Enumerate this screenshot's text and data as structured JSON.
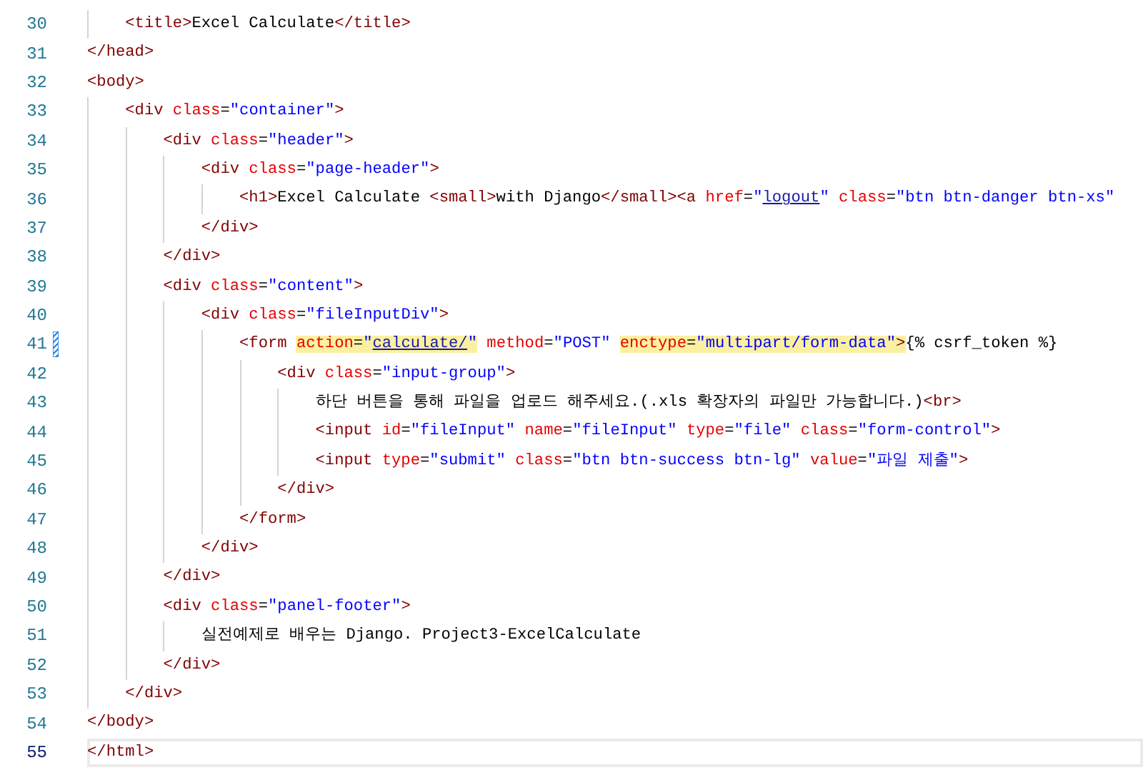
{
  "lines": [
    {
      "children": [
        {
          "number": "30",
          "current": false,
          "modified": false,
          "tokens": [
            {
              "kind": "tag",
              "text": "<title>"
            },
            {
              "kind": "text",
              "text": "Excel Calculate"
            },
            {
              "kind": "tag",
              "text": "</title>"
            }
          ]
        }
      ]
    },
    {
      "number": "31",
      "current": false,
      "modified": false,
      "tokens": [
        {
          "kind": "tag",
          "text": "</head>"
        }
      ]
    },
    {
      "number": "32",
      "current": false,
      "modified": false,
      "tokens": [
        {
          "kind": "tag",
          "text": "<body>"
        }
      ],
      "children": [
        {
          "number": "33",
          "current": false,
          "modified": false,
          "tokens": [
            {
              "kind": "tag",
              "text": "<div"
            },
            {
              "kind": "attr",
              "text": " class"
            },
            {
              "kind": "text",
              "text": "="
            },
            {
              "kind": "string",
              "text": "\"container\""
            },
            {
              "kind": "tag",
              "text": ">"
            }
          ],
          "children": [
            {
              "number": "34",
              "current": false,
              "modified": false,
              "tokens": [
                {
                  "kind": "tag",
                  "text": "<div"
                },
                {
                  "kind": "attr",
                  "text": " class"
                },
                {
                  "kind": "text",
                  "text": "="
                },
                {
                  "kind": "string",
                  "text": "\"header\""
                },
                {
                  "kind": "tag",
                  "text": ">"
                }
              ],
              "children": [
                {
                  "number": "35",
                  "current": false,
                  "modified": false,
                  "tokens": [
                    {
                      "kind": "tag",
                      "text": "<div"
                    },
                    {
                      "kind": "attr",
                      "text": " class"
                    },
                    {
                      "kind": "text",
                      "text": "="
                    },
                    {
                      "kind": "string",
                      "text": "\"page-header\""
                    },
                    {
                      "kind": "tag",
                      "text": ">"
                    }
                  ],
                  "children": [
                    {
                      "number": "36",
                      "current": false,
                      "modified": false,
                      "tokens": [
                        {
                          "kind": "tag",
                          "text": "<h1>"
                        },
                        {
                          "kind": "text",
                          "text": "Excel Calculate "
                        },
                        {
                          "kind": "tag",
                          "text": "<small>"
                        },
                        {
                          "kind": "text",
                          "text": "with Django"
                        },
                        {
                          "kind": "tag",
                          "text": "</small><a"
                        },
                        {
                          "kind": "attr",
                          "text": " href"
                        },
                        {
                          "kind": "text",
                          "text": "="
                        },
                        {
                          "kind": "string",
                          "text": "\""
                        },
                        {
                          "kind": "link",
                          "text": "logout"
                        },
                        {
                          "kind": "string",
                          "text": "\""
                        },
                        {
                          "kind": "attr",
                          "text": " class"
                        },
                        {
                          "kind": "text",
                          "text": "="
                        },
                        {
                          "kind": "string",
                          "text": "\"btn btn-danger btn-xs\""
                        }
                      ]
                    }
                  ]
                },
                {
                  "number": "37",
                  "current": false,
                  "modified": false,
                  "tokens": [
                    {
                      "kind": "tag",
                      "text": "</div>"
                    }
                  ]
                }
              ]
            },
            {
              "number": "38",
              "current": false,
              "modified": false,
              "tokens": [
                {
                  "kind": "tag",
                  "text": "</div>"
                }
              ]
            },
            {
              "number": "39",
              "current": false,
              "modified": false,
              "tokens": [
                {
                  "kind": "tag",
                  "text": "<div"
                },
                {
                  "kind": "attr",
                  "text": " class"
                },
                {
                  "kind": "text",
                  "text": "="
                },
                {
                  "kind": "string",
                  "text": "\"content\""
                },
                {
                  "kind": "tag",
                  "text": ">"
                }
              ],
              "children": [
                {
                  "number": "40",
                  "current": false,
                  "modified": false,
                  "tokens": [
                    {
                      "kind": "tag",
                      "text": "<div"
                    },
                    {
                      "kind": "attr",
                      "text": " class"
                    },
                    {
                      "kind": "text",
                      "text": "="
                    },
                    {
                      "kind": "string",
                      "text": "\"fileInputDiv\""
                    },
                    {
                      "kind": "tag",
                      "text": ">"
                    }
                  ],
                  "children": [
                    {
                      "number": "41",
                      "current": false,
                      "modified": true,
                      "tokens": [
                        {
                          "kind": "tag",
                          "text": "<form ",
                          "highlighted": false
                        },
                        {
                          "kind": "attr",
                          "text": "action",
                          "highlighted": true
                        },
                        {
                          "kind": "text",
                          "text": "=",
                          "highlighted": true
                        },
                        {
                          "kind": "string",
                          "text": "\"",
                          "highlighted": true
                        },
                        {
                          "kind": "link",
                          "text": "calculate/",
                          "highlighted": true
                        },
                        {
                          "kind": "string",
                          "text": "\"",
                          "highlighted": true
                        },
                        {
                          "kind": "attr",
                          "text": " method",
                          "highlighted": false
                        },
                        {
                          "kind": "text",
                          "text": "=",
                          "highlighted": false
                        },
                        {
                          "kind": "string",
                          "text": "\"POST\" ",
                          "highlighted": false
                        },
                        {
                          "kind": "attr",
                          "text": "enctype",
                          "highlighted": true
                        },
                        {
                          "kind": "text",
                          "text": "=",
                          "highlighted": true
                        },
                        {
                          "kind": "string",
                          "text": "\"multipart/form-data\"",
                          "highlighted": true
                        },
                        {
                          "kind": "tag",
                          "text": ">",
                          "highlighted": true
                        },
                        {
                          "kind": "text",
                          "text": "{% csrf_token %}",
                          "highlighted": false
                        }
                      ],
                      "children": [
                        {
                          "number": "42",
                          "current": false,
                          "modified": false,
                          "tokens": [
                            {
                              "kind": "tag",
                              "text": "<div"
                            },
                            {
                              "kind": "attr",
                              "text": " class"
                            },
                            {
                              "kind": "text",
                              "text": "="
                            },
                            {
                              "kind": "string",
                              "text": "\"input-group\""
                            },
                            {
                              "kind": "tag",
                              "text": ">"
                            }
                          ],
                          "children": [
                            {
                              "number": "43",
                              "current": false,
                              "modified": false,
                              "tokens": [
                                {
                                  "kind": "text",
                                  "text": "하단 버튼을 통해 파일을 업로드 해주세요.(.xls 확장자의 파일만 가능합니다.)"
                                },
                                {
                                  "kind": "tag",
                                  "text": "<br>"
                                }
                              ]
                            },
                            {
                              "number": "44",
                              "current": false,
                              "modified": false,
                              "tokens": [
                                {
                                  "kind": "tag",
                                  "text": "<input"
                                },
                                {
                                  "kind": "attr",
                                  "text": " id"
                                },
                                {
                                  "kind": "text",
                                  "text": "="
                                },
                                {
                                  "kind": "string",
                                  "text": "\"fileInput\""
                                },
                                {
                                  "kind": "attr",
                                  "text": " name"
                                },
                                {
                                  "kind": "text",
                                  "text": "="
                                },
                                {
                                  "kind": "string",
                                  "text": "\"fileInput\""
                                },
                                {
                                  "kind": "attr",
                                  "text": " type"
                                },
                                {
                                  "kind": "text",
                                  "text": "="
                                },
                                {
                                  "kind": "string",
                                  "text": "\"file\""
                                },
                                {
                                  "kind": "attr",
                                  "text": " class"
                                },
                                {
                                  "kind": "text",
                                  "text": "="
                                },
                                {
                                  "kind": "string",
                                  "text": "\"form-control\""
                                },
                                {
                                  "kind": "tag",
                                  "text": ">"
                                }
                              ]
                            },
                            {
                              "number": "45",
                              "current": false,
                              "modified": false,
                              "tokens": [
                                {
                                  "kind": "tag",
                                  "text": "<input"
                                },
                                {
                                  "kind": "attr",
                                  "text": " type"
                                },
                                {
                                  "kind": "text",
                                  "text": "="
                                },
                                {
                                  "kind": "string",
                                  "text": "\"submit\""
                                },
                                {
                                  "kind": "attr",
                                  "text": " class"
                                },
                                {
                                  "kind": "text",
                                  "text": "="
                                },
                                {
                                  "kind": "string",
                                  "text": "\"btn btn-success btn-lg\""
                                },
                                {
                                  "kind": "attr",
                                  "text": " value"
                                },
                                {
                                  "kind": "text",
                                  "text": "="
                                },
                                {
                                  "kind": "string",
                                  "text": "\"파일 제출\""
                                },
                                {
                                  "kind": "tag",
                                  "text": ">"
                                }
                              ]
                            }
                          ]
                        },
                        {
                          "number": "46",
                          "current": false,
                          "modified": false,
                          "tokens": [
                            {
                              "kind": "tag",
                              "text": "</div>"
                            }
                          ]
                        }
                      ]
                    },
                    {
                      "number": "47",
                      "current": false,
                      "modified": false,
                      "tokens": [
                        {
                          "kind": "tag",
                          "text": "</form>"
                        }
                      ]
                    }
                  ]
                },
                {
                  "number": "48",
                  "current": false,
                  "modified": false,
                  "tokens": [
                    {
                      "kind": "tag",
                      "text": "</div>"
                    }
                  ]
                }
              ]
            },
            {
              "number": "49",
              "current": false,
              "modified": false,
              "tokens": [
                {
                  "kind": "tag",
                  "text": "</div>"
                }
              ]
            },
            {
              "number": "50",
              "current": false,
              "modified": false,
              "tokens": [
                {
                  "kind": "tag",
                  "text": "<div"
                },
                {
                  "kind": "attr",
                  "text": " class"
                },
                {
                  "kind": "text",
                  "text": "="
                },
                {
                  "kind": "string",
                  "text": "\"panel-footer\""
                },
                {
                  "kind": "tag",
                  "text": ">"
                }
              ],
              "children": [
                {
                  "number": "51",
                  "current": false,
                  "modified": false,
                  "tokens": [
                    {
                      "kind": "text",
                      "text": "실전예제로 배우는 Django. Project3-ExcelCalculate"
                    }
                  ]
                }
              ]
            },
            {
              "number": "52",
              "current": false,
              "modified": false,
              "tokens": [
                {
                  "kind": "tag",
                  "text": "</div>"
                }
              ]
            }
          ]
        },
        {
          "number": "53",
          "current": false,
          "modified": false,
          "tokens": [
            {
              "kind": "tag",
              "text": "</div>"
            }
          ]
        }
      ]
    },
    {
      "number": "54",
      "current": false,
      "modified": false,
      "tokens": [
        {
          "kind": "tag",
          "text": "</body>"
        }
      ]
    },
    {
      "number": "55",
      "current": true,
      "modified": false,
      "tokens": [
        {
          "kind": "tag",
          "text": "</html>"
        }
      ]
    }
  ]
}
